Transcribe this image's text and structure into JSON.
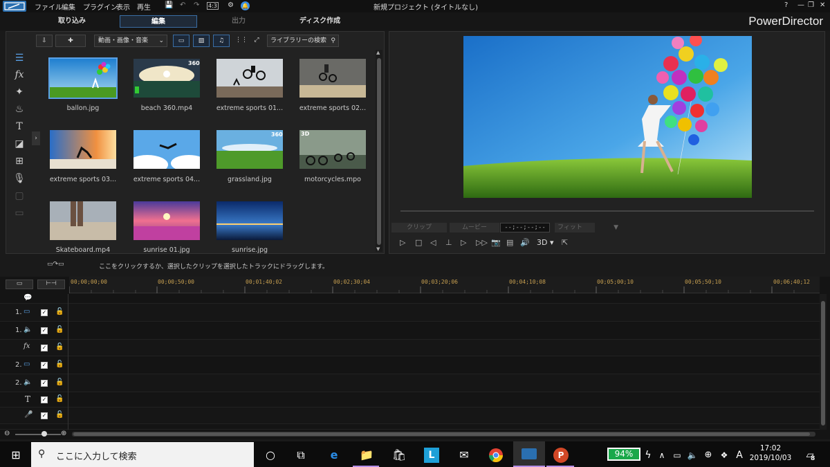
{
  "menu": {
    "items": [
      "ファイル",
      "編集",
      "プラグイン",
      "表示",
      "再生"
    ],
    "ratio": "4:3",
    "window_title": "新規プロジェクト (タイトルなし)",
    "help": "?"
  },
  "modes": {
    "capture": "取り込み",
    "edit": "編集",
    "produce": "出力",
    "disc": "ディスク作成",
    "brand": "PowerDirector"
  },
  "library": {
    "filter_select": "動画・画像・音楽",
    "search_placeholder": "ライブラリーの検索",
    "items": [
      {
        "name": "ballon.jpg",
        "badge": ""
      },
      {
        "name": "beach 360.mp4",
        "badge": "360"
      },
      {
        "name": "extreme sports 01...",
        "badge": ""
      },
      {
        "name": "extreme sports 02...",
        "badge": ""
      },
      {
        "name": "extreme sports 03...",
        "badge": ""
      },
      {
        "name": "extreme sports 04...",
        "badge": ""
      },
      {
        "name": "grassland.jpg",
        "badge": "360"
      },
      {
        "name": "motorcycles.mpo",
        "badge": "3D"
      },
      {
        "name": "Skateboard.mp4",
        "badge": ""
      },
      {
        "name": "sunrise 01.jpg",
        "badge": ""
      },
      {
        "name": "sunrise.jpg",
        "badge": ""
      }
    ]
  },
  "preview": {
    "clip_label": "クリップ",
    "movie_label": "ムービー",
    "timecode": "--;--;--;--",
    "fit_label": "フィット",
    "mode_3d": "3D"
  },
  "hint_text": "ここをクリックするか、選択したクリップを選択したトラックにドラッグします。",
  "timeline": {
    "ruler": [
      "00;00;00;00",
      "00;00;50;00",
      "00;01;40;02",
      "00;02;30;04",
      "00;03;20;06",
      "00;04;10;08",
      "00;05;00;10",
      "00;05;50;10",
      "00;06;40;12"
    ],
    "tracks": [
      {
        "num": "",
        "icon": "💬"
      },
      {
        "num": "1.",
        "icon": "▭"
      },
      {
        "num": "1.",
        "icon": "🔈"
      },
      {
        "num": "",
        "icon": "fx"
      },
      {
        "num": "2.",
        "icon": "▭"
      },
      {
        "num": "2.",
        "icon": "🔈"
      },
      {
        "num": "",
        "icon": "T"
      },
      {
        "num": "",
        "icon": "🎤"
      },
      {
        "num": "",
        "icon": ""
      }
    ]
  },
  "taskbar": {
    "search_placeholder": "ここに入力して検索",
    "battery": "94%",
    "ime": "A",
    "time": "17:02",
    "date": "2019/10/03",
    "notif_count": "8"
  }
}
